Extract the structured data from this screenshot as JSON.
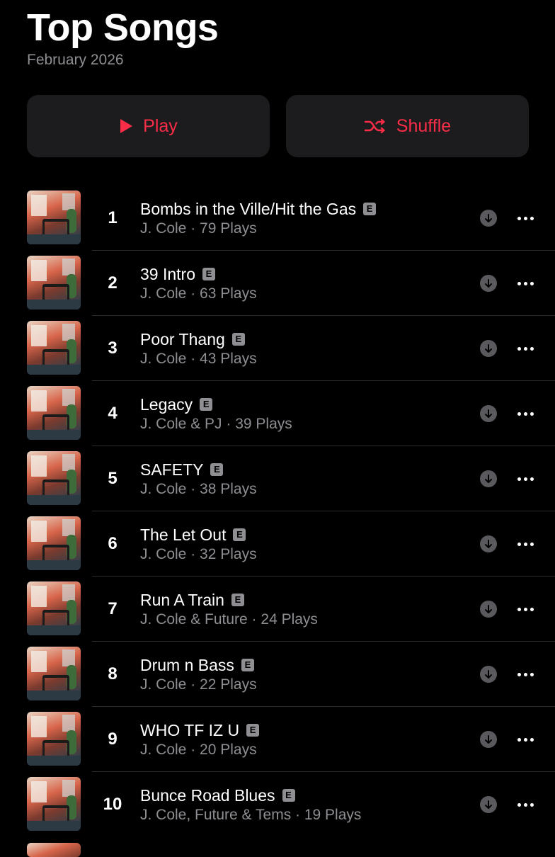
{
  "header": {
    "title": "Top Songs",
    "subtitle": "February 2026"
  },
  "buttons": {
    "play": "Play",
    "shuffle": "Shuffle"
  },
  "accent_color": "#fa2d48",
  "explicit_badge": "E",
  "songs": [
    {
      "rank": "1",
      "title": "Bombs in the Ville/Hit the Gas",
      "meta": "J. Cole · 79 Plays"
    },
    {
      "rank": "2",
      "title": "39 Intro",
      "meta": "J. Cole · 63 Plays"
    },
    {
      "rank": "3",
      "title": "Poor Thang",
      "meta": "J. Cole · 43 Plays"
    },
    {
      "rank": "4",
      "title": "Legacy",
      "meta": "J. Cole & PJ · 39 Plays"
    },
    {
      "rank": "5",
      "title": "SAFETY",
      "meta": "J. Cole · 38 Plays"
    },
    {
      "rank": "6",
      "title": "The Let Out",
      "meta": "J. Cole · 32 Plays"
    },
    {
      "rank": "7",
      "title": "Run A Train",
      "meta": "J. Cole & Future · 24 Plays"
    },
    {
      "rank": "8",
      "title": "Drum n Bass",
      "meta": "J. Cole · 22 Plays"
    },
    {
      "rank": "9",
      "title": "WHO TF IZ U",
      "meta": "J. Cole · 20 Plays"
    },
    {
      "rank": "10",
      "title": "Bunce Road Blues",
      "meta": "J. Cole, Future & Tems · 19 Plays"
    }
  ]
}
